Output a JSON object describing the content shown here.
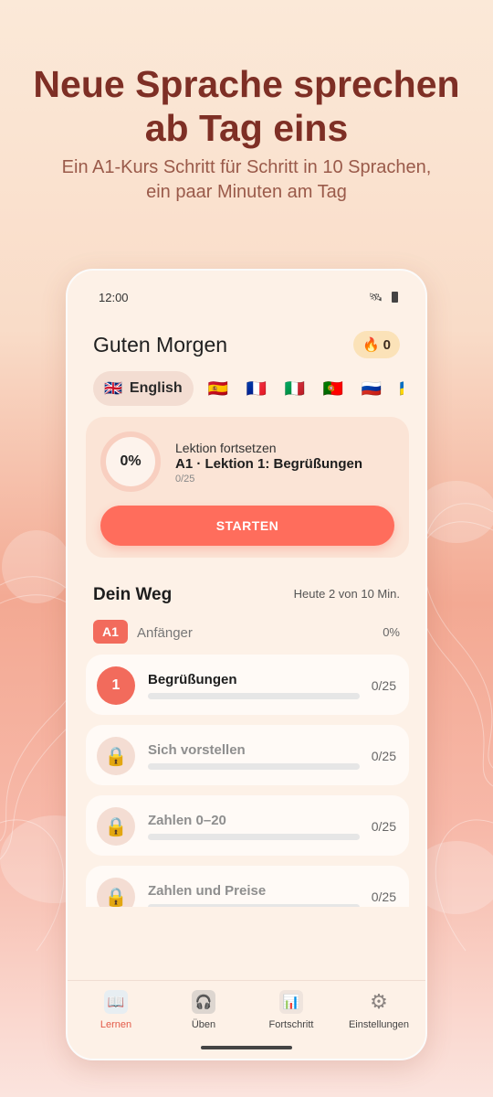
{
  "promo": {
    "headline_line1": "Neue Sprache sprechen",
    "headline_line2": "ab Tag eins",
    "subline_line1": "Ein A1-Kurs Schritt für Schritt in 10 Sprachen,",
    "subline_line2": "ein paar Minuten am Tag"
  },
  "status_bar": {
    "time": "12:00"
  },
  "header": {
    "greeting": "Guten Morgen",
    "streak_count": "0",
    "streak_icon": "flame-icon"
  },
  "languages": {
    "selected": {
      "flag": "🇬🇧",
      "label": "English"
    },
    "others": [
      {
        "flag": "🇪🇸",
        "name": "spanish"
      },
      {
        "flag": "🇫🇷",
        "name": "french"
      },
      {
        "flag": "🇮🇹",
        "name": "italian"
      },
      {
        "flag": "🇵🇹",
        "name": "portuguese"
      },
      {
        "flag": "🇷🇺",
        "name": "russian"
      },
      {
        "flag": "🇺🇦",
        "name": "ukrainian"
      }
    ]
  },
  "continue_card": {
    "progress_text": "0%",
    "label": "Lektion fortsetzen",
    "title": "A1 · Lektion 1: Begrüßungen",
    "count": "0/25",
    "button_label": "STARTEN"
  },
  "path": {
    "title": "Dein Weg",
    "today": "Heute 2 von 10 Min.",
    "level_badge": "A1",
    "level_name": "Anfänger",
    "level_progress": "0%"
  },
  "units": [
    {
      "number": "1",
      "title": "Begrüßungen",
      "count": "0/25",
      "locked": false,
      "progress": 0
    },
    {
      "number": "🔒",
      "title": "Sich vorstellen",
      "count": "0/25",
      "locked": true,
      "progress": 0
    },
    {
      "number": "🔒",
      "title": "Zahlen 0–20",
      "count": "0/25",
      "locked": true,
      "progress": 0
    },
    {
      "number": "🔒",
      "title": "Zahlen und Preise",
      "count": "0/25",
      "locked": true,
      "progress": 0
    }
  ],
  "tabs": [
    {
      "label": "Lernen",
      "icon": "book-icon",
      "glyph": "📖",
      "active": true
    },
    {
      "label": "Üben",
      "icon": "practice-icon",
      "glyph": "🎧",
      "active": false
    },
    {
      "label": "Fortschritt",
      "icon": "chart-icon",
      "glyph": "📊",
      "active": false
    },
    {
      "label": "Einstellungen",
      "icon": "gear-icon",
      "glyph": "⚙",
      "active": false
    }
  ],
  "colors": {
    "accent": "#f26b5c",
    "headline": "#7e2f25",
    "button": "#ff6d5c"
  }
}
